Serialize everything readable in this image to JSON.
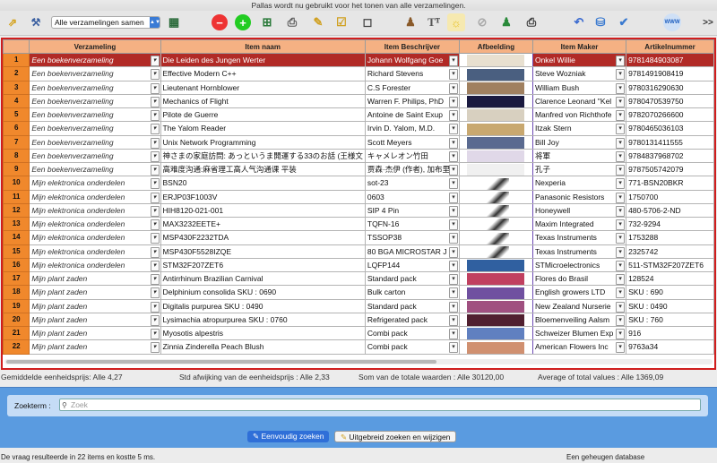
{
  "window": {
    "title": "Pallas wordt nu gebruikt voor het tonen van alle verzamelingen."
  },
  "toolbar": {
    "collection_select": "Alle verzamelingen samen",
    "overflow": ">>",
    "www": "WWW"
  },
  "grid": {
    "headers": [
      "Verzameling",
      "Item naam",
      "Item Beschrijver",
      "Afbeelding",
      "Item Maker",
      "Artikelnummer"
    ],
    "rows": [
      {
        "n": "1",
        "collection": "Een boekenverzameling",
        "name": "Die Leiden des Jungen Werter",
        "describer": "Johann Wolfgang Goe",
        "maker": "Onkel Willie",
        "article": "9781484903087",
        "thumb": "#e8e0d0"
      },
      {
        "n": "2",
        "collection": "Een boekenverzameling",
        "name": "Effective Modern C++",
        "describer": "Richard Stevens",
        "maker": "Steve Wozniak",
        "article": "9781491908419",
        "thumb": "#4a5f80"
      },
      {
        "n": "3",
        "collection": "Een boekenverzameling",
        "name": "Lieutenant Hornblower",
        "describer": "C.S Forester",
        "maker": "William Bush",
        "article": "9780316290630",
        "thumb": "#a08060"
      },
      {
        "n": "4",
        "collection": "Een boekenverzameling",
        "name": "Mechanics of Flight",
        "describer": "Warren F. Philips, PhD",
        "maker": "Clarence Leonard \"Kel",
        "article": "9780470539750",
        "thumb": "#1a1a40"
      },
      {
        "n": "5",
        "collection": "Een boekenverzameling",
        "name": "Pilote de Guerre",
        "describer": "Antoine de Saint Exup",
        "maker": "Manfred von Richthofe",
        "article": "9782070266600",
        "thumb": "#d8d0c0"
      },
      {
        "n": "6",
        "collection": "Een boekenverzameling",
        "name": "The Yalom Reader",
        "describer": "Irvin D. Yalom, M.D.",
        "maker": "Itzak Stern",
        "article": "9780465036103",
        "thumb": "#c8a870"
      },
      {
        "n": "7",
        "collection": "Een boekenverzameling",
        "name": "Unix Network Programming",
        "describer": "Scott Meyers",
        "maker": "Bill Joy",
        "article": "9780131411555",
        "thumb": "#5a6a90"
      },
      {
        "n": "8",
        "collection": "Een boekenverzameling",
        "name": "神さまの家庭訪問: あっというま開運する33のお話 (王様文",
        "describer": "キャメレオン竹田",
        "maker": "将軍",
        "article": "9784837968702",
        "thumb": "#e0d8e8"
      },
      {
        "n": "9",
        "collection": "Een boekenverzameling",
        "name": "高难度沟通:麻省理工高人气沟通课 平装",
        "describer": "贾森·杰伊 (作者), 加布里",
        "maker": "孔子",
        "article": "9787505742079",
        "thumb": "#f0f0f0"
      },
      {
        "n": "10",
        "collection": "Mijn elektronica onderdelen",
        "name": "BSN20",
        "describer": "sot-23",
        "maker": "Nexperia",
        "article": "771-BSN20BKR",
        "thumb": "#ffffff"
      },
      {
        "n": "11",
        "collection": "Mijn elektronica onderdelen",
        "name": "ERJP03F1003V",
        "describer": "0603",
        "maker": "Panasonic Resistors",
        "article": "1750700",
        "thumb": "#ffffff"
      },
      {
        "n": "12",
        "collection": "Mijn elektronica onderdelen",
        "name": "HIH8120-021-001",
        "describer": "SIP 4 Pin",
        "maker": "Honeywell",
        "article": "480-5706-2-ND",
        "thumb": "#ffffff"
      },
      {
        "n": "13",
        "collection": "Mijn elektronica onderdelen",
        "name": "MAX3232EETE+",
        "describer": "TQFN-16",
        "maker": "Maxim Integrated",
        "article": "732-9294",
        "thumb": "#ffffff"
      },
      {
        "n": "14",
        "collection": "Mijn elektronica onderdelen",
        "name": "MSP430F2232TDA",
        "describer": "TSSOP38",
        "maker": "Texas Instruments",
        "article": "1753288",
        "thumb": "#ffffff"
      },
      {
        "n": "15",
        "collection": "Mijn elektronica onderdelen",
        "name": "MSP430F5528IZQE",
        "describer": "80 BGA MICROSTAR J",
        "maker": "Texas Instruments",
        "article": "2325742",
        "thumb": "#ffffff"
      },
      {
        "n": "16",
        "collection": "Mijn elektronica onderdelen",
        "name": "STM32F207ZET6",
        "describer": "LQFP144",
        "maker": "STMicroelectronics",
        "article": "511-STM32F207ZET6",
        "thumb": "#3060a0"
      },
      {
        "n": "17",
        "collection": "Mijn plant zaden",
        "name": "Antirrhinum Brazilian Carnival",
        "describer": "Standard pack",
        "maker": "Flores do Brasil",
        "article": "128524",
        "thumb": "#c04060"
      },
      {
        "n": "18",
        "collection": "Mijn plant zaden",
        "name": "Delphinium consolida SKU : 0690",
        "describer": "Bulk carton",
        "maker": "English growers LTD",
        "article": "SKU : 690",
        "thumb": "#7050a0"
      },
      {
        "n": "19",
        "collection": "Mijn plant zaden",
        "name": "Digitalis purpurea SKU : 0490",
        "describer": "Standard pack",
        "maker": "New Zealand Nurserie",
        "article": "SKU : 0490",
        "thumb": "#a05080"
      },
      {
        "n": "20",
        "collection": "Mijn plant zaden",
        "name": "Lysimachia atropurpurea SKU : 0760",
        "describer": "Refrigerated pack",
        "maker": "Bloemenveiling Aalsm",
        "article": "SKU : 760",
        "thumb": "#502030"
      },
      {
        "n": "21",
        "collection": "Mijn plant zaden",
        "name": "Myosotis alpestris",
        "describer": "Combi pack",
        "maker": "Schweizer Blumen Exp",
        "article": "916",
        "thumb": "#6080c0"
      },
      {
        "n": "22",
        "collection": "Mijn plant zaden",
        "name": "Zinnia Zinderella Peach Blush",
        "describer": "Combi pack",
        "maker": "American Flowers Inc",
        "article": "9763a34",
        "thumb": "#d09070"
      }
    ]
  },
  "stats": {
    "avg_price": "Gemiddelde eenheidsprijs:  Alle 4,27",
    "std_price": "Std afwijking van de eenheidsprijs :  Alle 2,33",
    "sum_total": "Som van de totale waarden :  Alle 30120,00",
    "avg_total": "Average of total values :  Alle 1369,09"
  },
  "search": {
    "label": "Zoekterm :",
    "placeholder": "Zoek",
    "simple_button": "Eenvoudig zoeken",
    "advanced_button": "Uitgebreid zoeken en wijzigen"
  },
  "status": {
    "left": "De vraag resulteerde in 22 items en kostte 5 ms.",
    "right": "Een geheugen database"
  },
  "colors": {
    "selected_row": "#b12a26",
    "header": "#f5b183",
    "row_number": "#f0882c",
    "grid_border": "#d01e1e",
    "search_panel": "#5a9be0"
  }
}
